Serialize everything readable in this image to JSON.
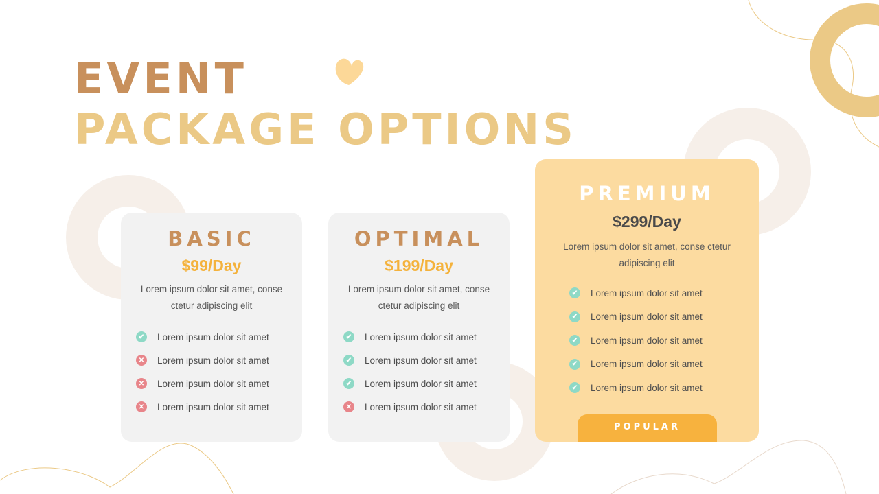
{
  "title": {
    "line1": "EVENT",
    "line2": "PACKAGE OPTIONS"
  },
  "colors": {
    "accent_brown": "#c8905c",
    "accent_gold": "#ebc986",
    "price_orange": "#f4b23c",
    "premium_bg": "#fcdba0",
    "card_bg": "#f2f2f2",
    "check": "#8ed9c6",
    "cross": "#e8858a",
    "popular_bg": "#f7b23e"
  },
  "cards": [
    {
      "name": "BASIC",
      "price": "$99/Day",
      "description": "Lorem ipsum dolor sit amet, conse ctetur adipiscing  elit",
      "features": [
        {
          "text": "Lorem ipsum dolor sit amet",
          "included": true,
          "icon": "check-icon"
        },
        {
          "text": "Lorem ipsum dolor sit amet",
          "included": false,
          "icon": "cross-icon"
        },
        {
          "text": "Lorem ipsum dolor sit amet",
          "included": false,
          "icon": "cross-icon"
        },
        {
          "text": "Lorem ipsum dolor sit amet",
          "included": false,
          "icon": "cross-icon"
        }
      ]
    },
    {
      "name": "OPTIMAL",
      "price": "$199/Day",
      "description": "Lorem ipsum dolor sit amet, conse ctetur adipiscing  elit",
      "features": [
        {
          "text": "Lorem ipsum dolor sit amet",
          "included": true,
          "icon": "check-icon"
        },
        {
          "text": "Lorem ipsum dolor sit amet",
          "included": true,
          "icon": "check-icon"
        },
        {
          "text": "Lorem ipsum dolor sit amet",
          "included": true,
          "icon": "check-icon"
        },
        {
          "text": "Lorem ipsum dolor sit amet",
          "included": false,
          "icon": "cross-icon"
        }
      ]
    },
    {
      "name": "PREMIUM",
      "price": "$299/Day",
      "description": "Lorem ipsum dolor sit amet, conse ctetur adipiscing  elit",
      "features": [
        {
          "text": "Lorem ipsum dolor sit amet",
          "included": true,
          "icon": "check-icon"
        },
        {
          "text": "Lorem ipsum dolor sit amet",
          "included": true,
          "icon": "check-icon"
        },
        {
          "text": "Lorem ipsum dolor sit amet",
          "included": true,
          "icon": "check-icon"
        },
        {
          "text": "Lorem ipsum dolor sit amet",
          "included": true,
          "icon": "check-icon"
        },
        {
          "text": "Lorem ipsum dolor sit amet",
          "included": true,
          "icon": "check-icon"
        }
      ],
      "badge": "POPULAR"
    }
  ]
}
